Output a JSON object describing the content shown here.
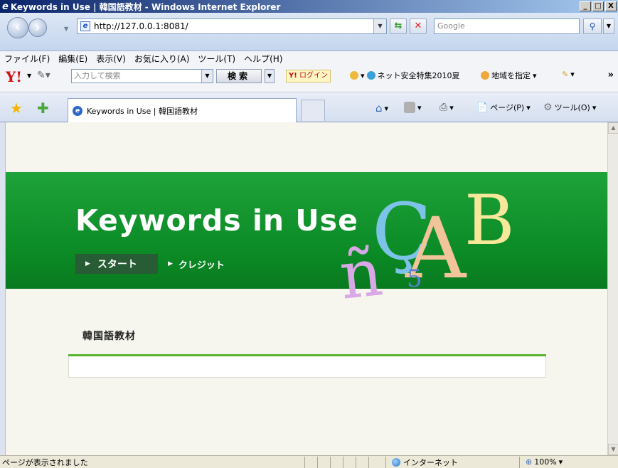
{
  "window": {
    "title": "Keywords in Use | 韓国語教材 - Windows Internet Explorer",
    "minimize": "_",
    "maximize": "□",
    "close": "X"
  },
  "address_bar": {
    "url": "http://127.0.0.1:8081/",
    "search_placeholder": "Google"
  },
  "menu": [
    "ファイル(F)",
    "編集(E)",
    "表示(V)",
    "お気に入り(A)",
    "ツール(T)",
    "ヘルプ(H)"
  ],
  "yahoo_toolbar": {
    "logo": "Y!",
    "search_placeholder": "入力して検索",
    "search_button": "検索",
    "login": "ログイン",
    "safety": "ネット安全特集2010夏",
    "region": "地域を指定",
    "more": "»"
  },
  "tab": {
    "title": "Keywords in Use | 韓国語教材"
  },
  "command_bar": {
    "page": "ページ(P)",
    "tools": "ツール(O)"
  },
  "page": {
    "site_title": "Keywords in Use",
    "nav_start": "スタート",
    "nav_credit": "クレジット",
    "section_title": "韓国語教材"
  },
  "status_bar": {
    "message": "ページが表示されました",
    "zone": "インターネット",
    "zoom": "100%"
  },
  "colors": {
    "banner_green": "#0b8a25",
    "nav_active": "#285c34",
    "accent_line": "#58b42d",
    "content_bg": "#f6f6ee"
  }
}
